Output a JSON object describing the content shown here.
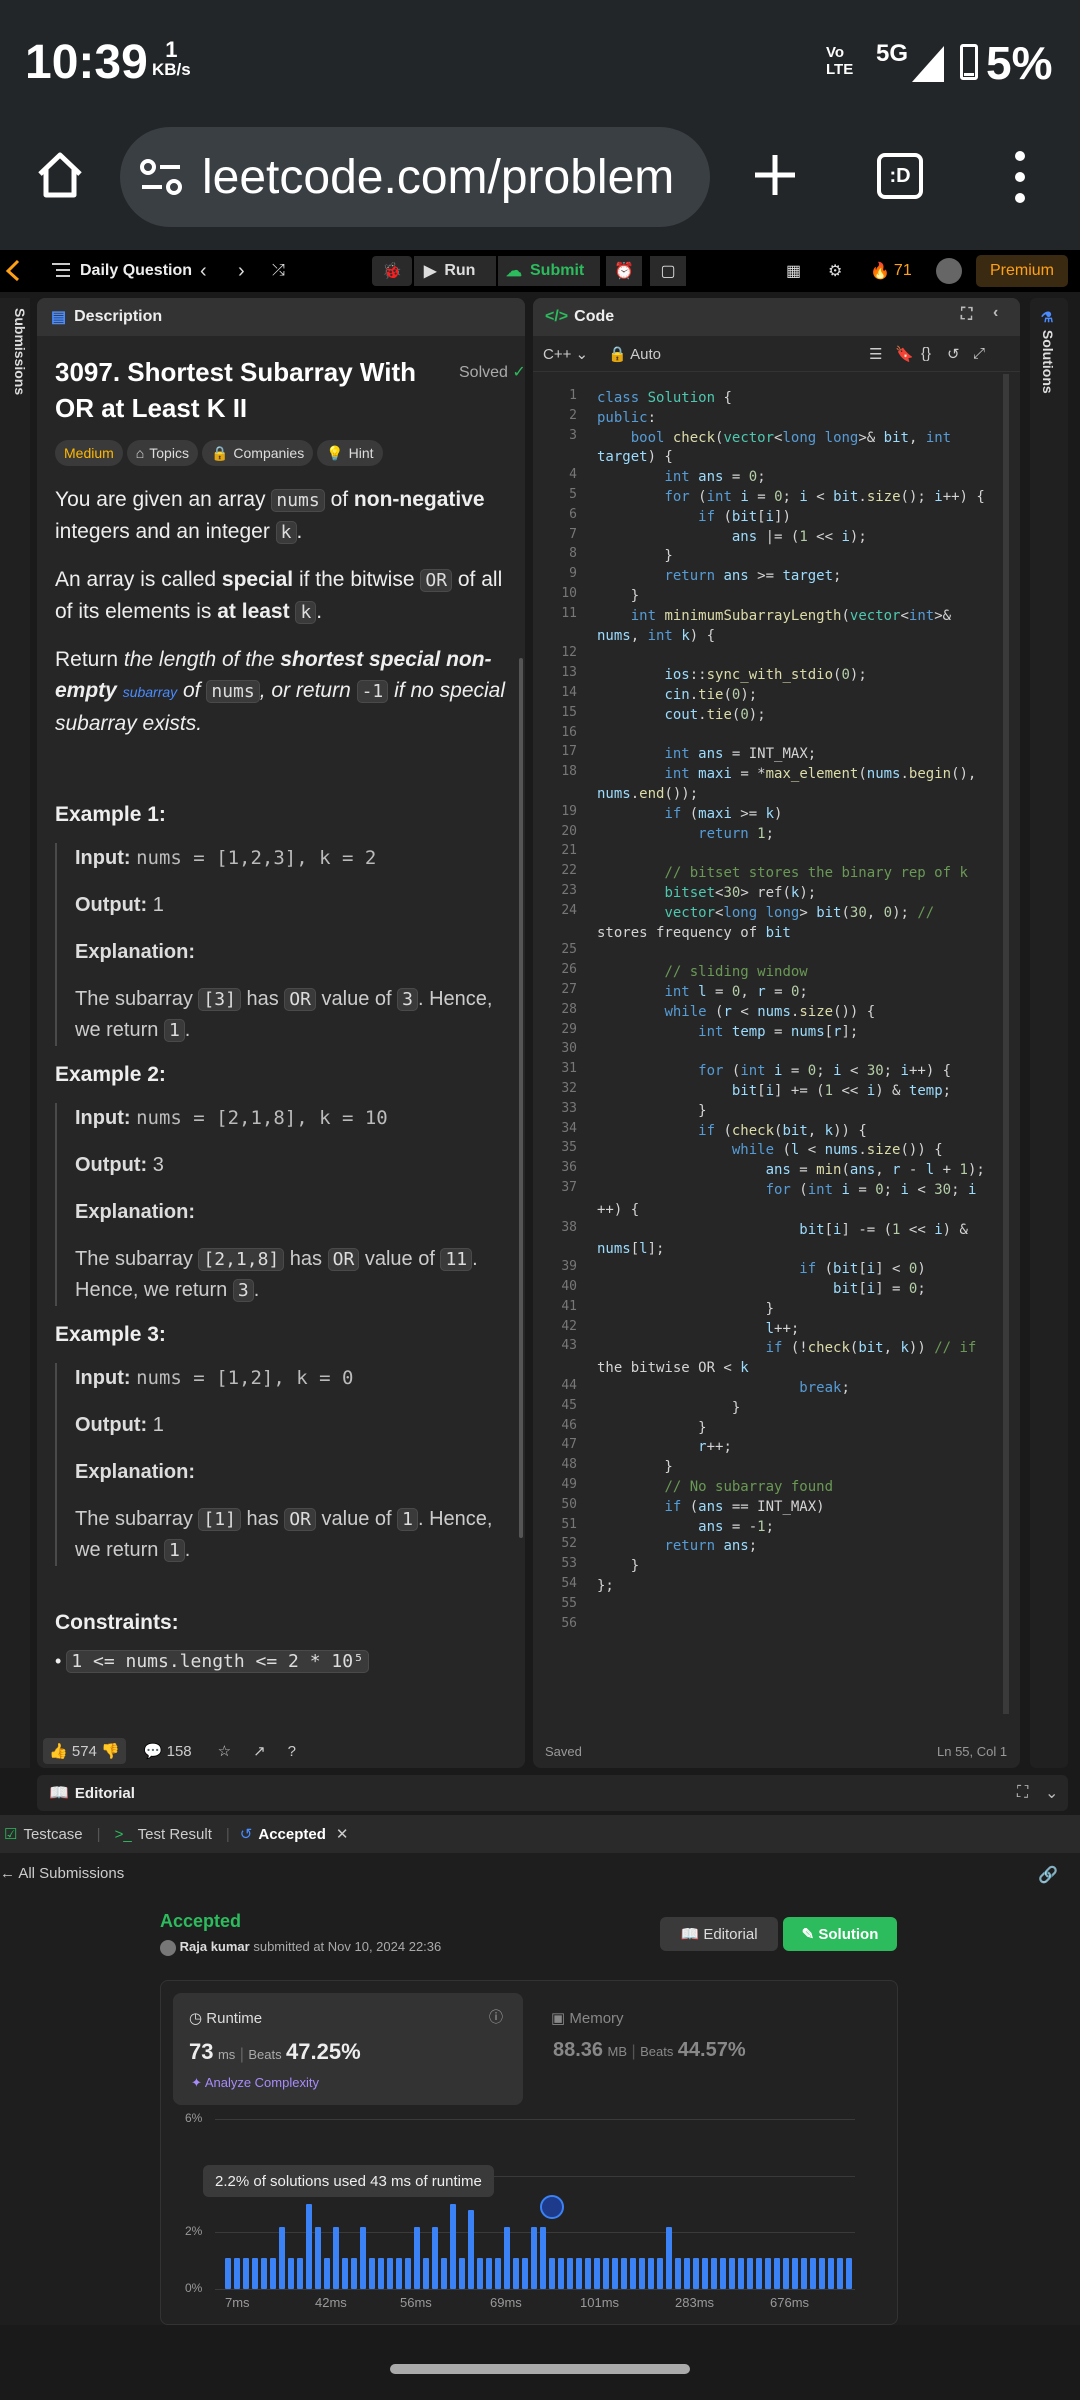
{
  "status": {
    "time": "10:39",
    "speed_val": "1",
    "speed_unit": "KB/s",
    "net": "Vo LTE",
    "net2": "5G",
    "battery": "5%"
  },
  "browser": {
    "url": "leetcode.com/problem"
  },
  "topbar": {
    "daily": "Daily Question",
    "run": "Run",
    "submit": "Submit",
    "streak": "71",
    "premium": "Premium"
  },
  "left_strip": {
    "label": "Submissions"
  },
  "right_strip": {
    "label": "Solutions"
  },
  "desc": {
    "tab": "Description",
    "title": "3097. Shortest Subarray With OR at Least K II",
    "solved": "Solved",
    "tags": [
      "Medium",
      "Topics",
      "Companies",
      "Hint"
    ],
    "p1a": "You are given an array ",
    "p1code": "nums",
    "p1b": " of ",
    "p1bold": "non-negative",
    "p1c": " integers and an integer ",
    "p1code2": "k",
    "p1d": ".",
    "p2a": "An array is called ",
    "p2bold": "special",
    "p2b": " if the bitwise ",
    "p2code": "OR",
    "p2c": " of all of its elements is ",
    "p2bold2": "at least",
    "p2d": " ",
    "p2code2": "k",
    "p2e": ".",
    "p3a": "Return ",
    "p3i": "the length of the ",
    "p3bi": "shortest special non-empty",
    "p3sub": "subarray",
    "p3i2": " of ",
    "p3code": "nums",
    "p3i3": ", or return ",
    "p3code2": "-1",
    "p3i4": " if no special subarray exists.",
    "examples": [
      {
        "h": "Example 1:",
        "input_label": "Input:",
        "input": "nums = [1,2,3], k = 2",
        "output_label": "Output:",
        "output": "1",
        "exp_label": "Explanation:",
        "e1": "The subarray ",
        "ec1": "[3]",
        "e2": " has ",
        "ec2": "OR",
        "e3": " value of ",
        "ec3": "3",
        "e4": ". Hence, we return ",
        "ec4": "1",
        "e5": "."
      },
      {
        "h": "Example 2:",
        "input_label": "Input:",
        "input": "nums = [2,1,8], k = 10",
        "output_label": "Output:",
        "output": "3",
        "exp_label": "Explanation:",
        "e1": "The subarray ",
        "ec1": "[2,1,8]",
        "e2": " has ",
        "ec2": "OR",
        "e3": " value of ",
        "ec3": "11",
        "e4": ". Hence, we return ",
        "ec4": "3",
        "e5": "."
      },
      {
        "h": "Example 3:",
        "input_label": "Input:",
        "input": "nums = [1,2], k = 0",
        "output_label": "Output:",
        "output": "1",
        "exp_label": "Explanation:",
        "e1": "The subarray ",
        "ec1": "[1]",
        "e2": " has ",
        "ec2": "OR",
        "e3": " value of ",
        "ec3": "1",
        "e4": ". Hence, we return ",
        "ec4": "1",
        "e5": "."
      }
    ],
    "constraints_h": "Constraints:",
    "constraint1": "1 <= nums.length <= 2 * 10⁵",
    "likes": "574",
    "comments": "158"
  },
  "code": {
    "tab": "Code",
    "lang": "C++",
    "auto": "Auto",
    "saved": "Saved",
    "cursor": "Ln 55, Col 1",
    "lines": [
      {
        "n": "1",
        "t": "class Solution {"
      },
      {
        "n": "2",
        "t": "public:"
      },
      {
        "n": "3",
        "t": "    bool check(vector<long long>& bit, int"
      },
      {
        "n": "",
        "t": "target) {"
      },
      {
        "n": "4",
        "t": "        int ans = 0;"
      },
      {
        "n": "5",
        "t": "        for (int i = 0; i < bit.size(); i++) {"
      },
      {
        "n": "6",
        "t": "            if (bit[i])"
      },
      {
        "n": "7",
        "t": "                ans |= (1 << i);"
      },
      {
        "n": "8",
        "t": "        }"
      },
      {
        "n": "9",
        "t": "        return ans >= target;"
      },
      {
        "n": "10",
        "t": "    }"
      },
      {
        "n": "11",
        "t": "    int minimumSubarrayLength(vector<int>&"
      },
      {
        "n": "",
        "t": "nums, int k) {"
      },
      {
        "n": "12",
        "t": ""
      },
      {
        "n": "13",
        "t": "        ios::sync_with_stdio(0);"
      },
      {
        "n": "14",
        "t": "        cin.tie(0);"
      },
      {
        "n": "15",
        "t": "        cout.tie(0);"
      },
      {
        "n": "16",
        "t": ""
      },
      {
        "n": "17",
        "t": "        int ans = INT_MAX;"
      },
      {
        "n": "18",
        "t": "        int maxi = *max_element(nums.begin(),"
      },
      {
        "n": "",
        "t": "nums.end());"
      },
      {
        "n": "19",
        "t": "        if (maxi >= k)"
      },
      {
        "n": "20",
        "t": "            return 1;"
      },
      {
        "n": "21",
        "t": ""
      },
      {
        "n": "22",
        "t": "        // bitset stores the binary rep of k"
      },
      {
        "n": "23",
        "t": "        bitset<30> ref(k);"
      },
      {
        "n": "24",
        "t": "        vector<long long> bit(30, 0); //"
      },
      {
        "n": "",
        "t": "stores frequency of bit"
      },
      {
        "n": "25",
        "t": ""
      },
      {
        "n": "26",
        "t": "        // sliding window"
      },
      {
        "n": "27",
        "t": "        int l = 0, r = 0;"
      },
      {
        "n": "28",
        "t": "        while (r < nums.size()) {"
      },
      {
        "n": "29",
        "t": "            int temp = nums[r];"
      },
      {
        "n": "30",
        "t": ""
      },
      {
        "n": "31",
        "t": "            for (int i = 0; i < 30; i++) {"
      },
      {
        "n": "32",
        "t": "                bit[i] += (1 << i) & temp;"
      },
      {
        "n": "33",
        "t": "            }"
      },
      {
        "n": "34",
        "t": "            if (check(bit, k)) {"
      },
      {
        "n": "35",
        "t": "                while (l < nums.size()) {"
      },
      {
        "n": "36",
        "t": "                    ans = min(ans, r - l + 1);"
      },
      {
        "n": "37",
        "t": "                    for (int i = 0; i < 30; i"
      },
      {
        "n": "",
        "t": "++) {"
      },
      {
        "n": "38",
        "t": "                        bit[i] -= (1 << i) &"
      },
      {
        "n": "",
        "t": "nums[l];"
      },
      {
        "n": "39",
        "t": "                        if (bit[i] < 0)"
      },
      {
        "n": "40",
        "t": "                            bit[i] = 0;"
      },
      {
        "n": "41",
        "t": "                    }"
      },
      {
        "n": "42",
        "t": "                    l++;"
      },
      {
        "n": "43",
        "t": "                    if (!check(bit, k)) // if"
      },
      {
        "n": "",
        "t": "the bitwise OR < k"
      },
      {
        "n": "44",
        "t": "                        break;"
      },
      {
        "n": "45",
        "t": "                }"
      },
      {
        "n": "46",
        "t": "            }"
      },
      {
        "n": "47",
        "t": "            r++;"
      },
      {
        "n": "48",
        "t": "        }"
      },
      {
        "n": "49",
        "t": "        // No subarray found"
      },
      {
        "n": "50",
        "t": "        if (ans == INT_MAX)"
      },
      {
        "n": "51",
        "t": "            ans = -1;"
      },
      {
        "n": "52",
        "t": "        return ans;"
      },
      {
        "n": "53",
        "t": "    }"
      },
      {
        "n": "54",
        "t": "};"
      },
      {
        "n": "55",
        "t": ""
      },
      {
        "n": "56",
        "t": ""
      }
    ]
  },
  "editorial_bar": {
    "label": "Editorial"
  },
  "result_tabs": {
    "testcase": "Testcase",
    "test_result": "Test Result",
    "accepted": "Accepted"
  },
  "submission": {
    "back": "All Submissions",
    "status": "Accepted",
    "user": "Raja kumar",
    "submitted": "submitted at Nov 10, 2024 22:36",
    "editorial_btn": "Editorial",
    "solution_btn": "Solution",
    "runtime_label": "Runtime",
    "runtime_val": "73",
    "runtime_unit": "ms",
    "beats_label": "Beats",
    "runtime_beats": "47.25%",
    "analyze": "Analyze Complexity",
    "memory_label": "Memory",
    "memory_val": "88.36",
    "memory_unit": "MB",
    "memory_beats": "44.57%",
    "tooltip": "2.2% of solutions used 43 ms of runtime"
  },
  "chart_data": {
    "type": "bar",
    "y_ticks": [
      "6%",
      "2%",
      "0%"
    ],
    "x_ticks": [
      "7ms",
      "42ms",
      "56ms",
      "69ms",
      "101ms",
      "283ms",
      "676ms"
    ],
    "ylim": [
      0,
      6
    ],
    "values": [
      1.1,
      1.1,
      1.1,
      1.1,
      1.1,
      1.1,
      2.2,
      1.1,
      1.1,
      3.0,
      2.2,
      1.1,
      2.2,
      1.1,
      1.1,
      2.2,
      1.1,
      1.1,
      1.1,
      1.1,
      1.1,
      2.2,
      1.1,
      2.2,
      1.1,
      3.0,
      1.1,
      2.8,
      1.1,
      1.1,
      1.1,
      2.2,
      1.1,
      1.1,
      2.2,
      2.2,
      1.1,
      1.1,
      1.1,
      1.1,
      1.1,
      1.1,
      1.1,
      1.1,
      1.1,
      1.1,
      1.1,
      1.1,
      1.1,
      2.2,
      1.1,
      1.1,
      1.1,
      1.1,
      1.1,
      1.1,
      1.1,
      1.1,
      1.1,
      1.1,
      1.1,
      1.1,
      1.1,
      1.1,
      1.1,
      1.1,
      1.1,
      1.1,
      1.1,
      1.1
    ]
  }
}
